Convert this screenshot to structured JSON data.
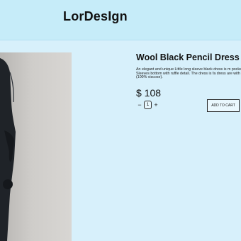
{
  "header": {
    "brand": "LorDesIgn"
  },
  "product": {
    "title": "Wool Black Pencil Dress d",
    "description": "An elegant and unique Little long sleeve black dress is m pockets. Sleeves bottom with ruffle detail. The dress is fa dress are with lined (100% viscose).",
    "price": "$ 108",
    "quantity": "1",
    "minus_label": "−",
    "plus_label": "+",
    "add_to_cart_label": "ADD TO CART"
  },
  "colors": {
    "page_bg": "#d7f0fb",
    "header_bg": "#c6ecf9",
    "hero_bg": "#cfcdca",
    "garment": "#1f2328"
  }
}
